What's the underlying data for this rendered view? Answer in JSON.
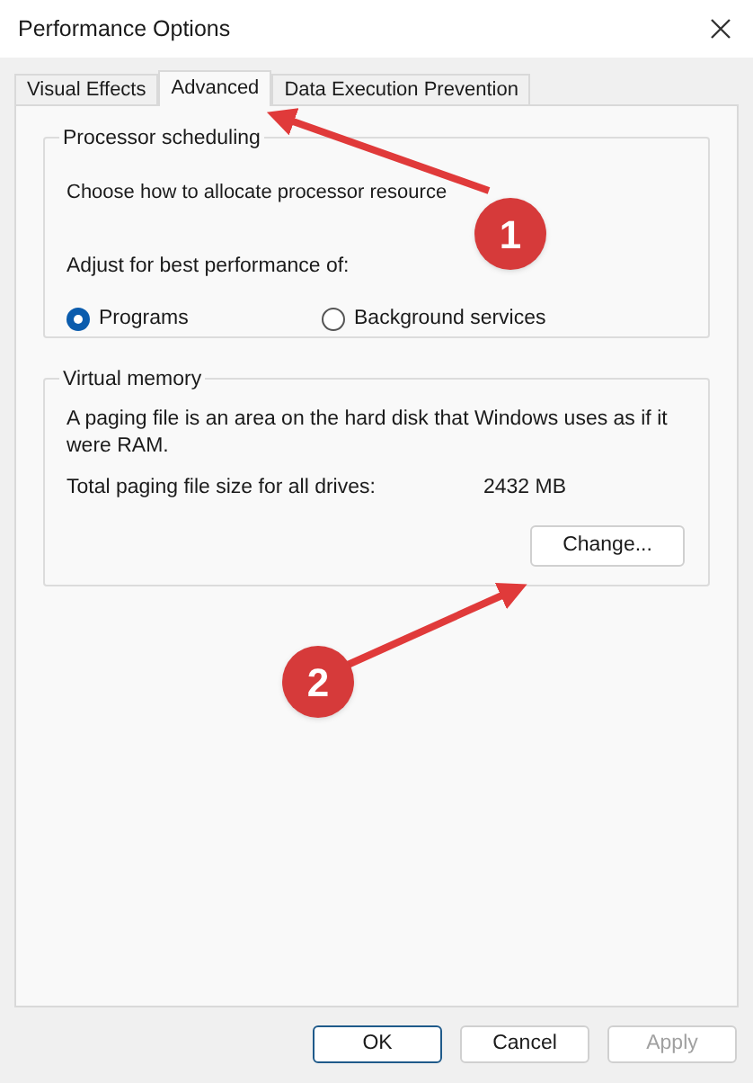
{
  "window": {
    "title": "Performance Options"
  },
  "tabs": [
    {
      "label": "Visual Effects",
      "selected": false
    },
    {
      "label": "Advanced",
      "selected": true
    },
    {
      "label": "Data Execution Prevention",
      "selected": false
    }
  ],
  "processor_scheduling": {
    "title": "Processor scheduling",
    "description": "Choose how to allocate processor resource",
    "prompt": "Adjust for best performance of:",
    "options": [
      {
        "label": "Programs",
        "selected": true
      },
      {
        "label": "Background services",
        "selected": false
      }
    ]
  },
  "virtual_memory": {
    "title": "Virtual memory",
    "description": "A paging file is an area on the hard disk that Windows uses as if it were RAM.",
    "size_label": "Total paging file size for all drives:",
    "size_value": "2432 MB",
    "button": "Change..."
  },
  "buttons": [
    {
      "label": "OK",
      "kind": "default",
      "disabled": false
    },
    {
      "label": "Cancel",
      "kind": "normal",
      "disabled": false
    },
    {
      "label": "Apply",
      "kind": "normal",
      "disabled": true
    }
  ],
  "annotations": [
    {
      "label": "1"
    },
    {
      "label": "2"
    }
  ]
}
